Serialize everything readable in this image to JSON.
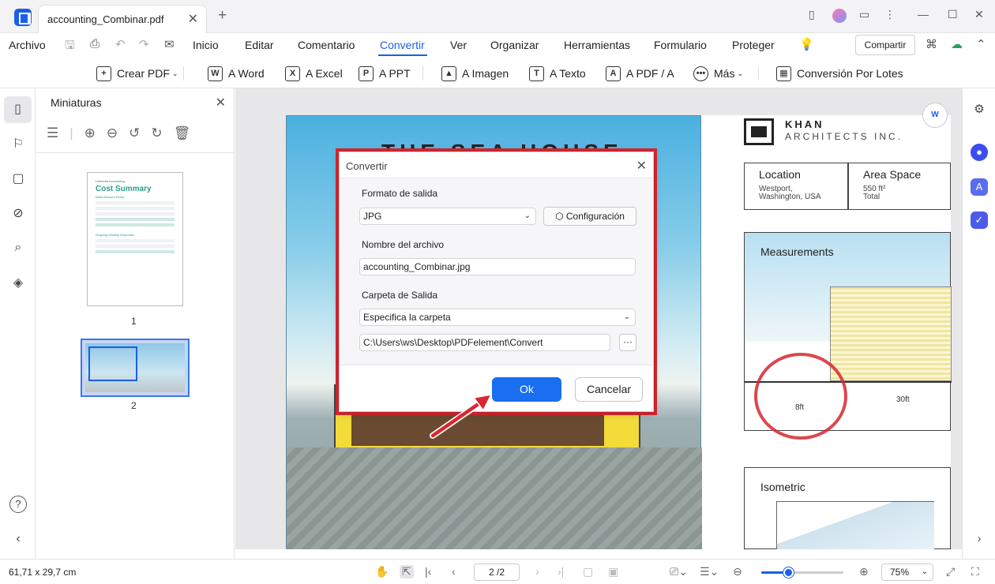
{
  "titlebar": {
    "tab_title": "accounting_Combinar.pdf"
  },
  "menu": {
    "items": [
      "Archivo",
      "Inicio",
      "Editar",
      "Comentario",
      "Convertir",
      "Ver",
      "Organizar",
      "Herramientas",
      "Formulario",
      "Proteger"
    ],
    "share": "Compartir"
  },
  "toolbar": {
    "items": [
      "Crear PDF",
      "A Word",
      "A Excel",
      "A PPT",
      "A Imagen",
      "A Texto",
      "A PDF / A",
      "Más",
      "Conversión Por Lotes"
    ]
  },
  "thumbnails": {
    "title": "Miniaturas",
    "pages": [
      "1",
      "2"
    ],
    "thumb1": {
      "brand": "Umbrella Accounting",
      "heading": "Cost Summary",
      "sub1": "Initial Account Setup",
      "sub2": "Ongoing Monthly Expenses"
    }
  },
  "document": {
    "poster_title": "THE SEA HOUSE",
    "company_name": "KHAN",
    "company_sub": "ARCHITECTS INC.",
    "location_label": "Location",
    "location_value": "Westport, Washington, USA",
    "area_label": "Area Space",
    "area_value": "550 ft²",
    "area_sub": "Total",
    "measurements_title": "Measurements",
    "dim_8ft": "8ft",
    "dim_30ft": "30ft",
    "isometric_title": "Isometric"
  },
  "dialog": {
    "title": "Convertir",
    "format_label": "Formato de salida",
    "format_value": "JPG",
    "config_button": "Configuración",
    "filename_label": "Nombre del archivo",
    "filename_value": "accounting_Combinar.jpg",
    "folder_label": "Carpeta de Salida",
    "folder_option": "Especifica la carpeta",
    "folder_path": "C:\\Users\\ws\\Desktop\\PDFelement\\Convert",
    "more_button": "···",
    "ok": "Ok",
    "cancel": "Cancelar"
  },
  "statusbar": {
    "dimensions": "61,71 x 29,7 cm",
    "page": "2 /2",
    "zoom": "75%",
    "zoom_level": 0.33
  },
  "colors": {
    "accent": "#1a5fe8",
    "highlight": "#d9262f",
    "ok_button": "#1a6ef0"
  }
}
